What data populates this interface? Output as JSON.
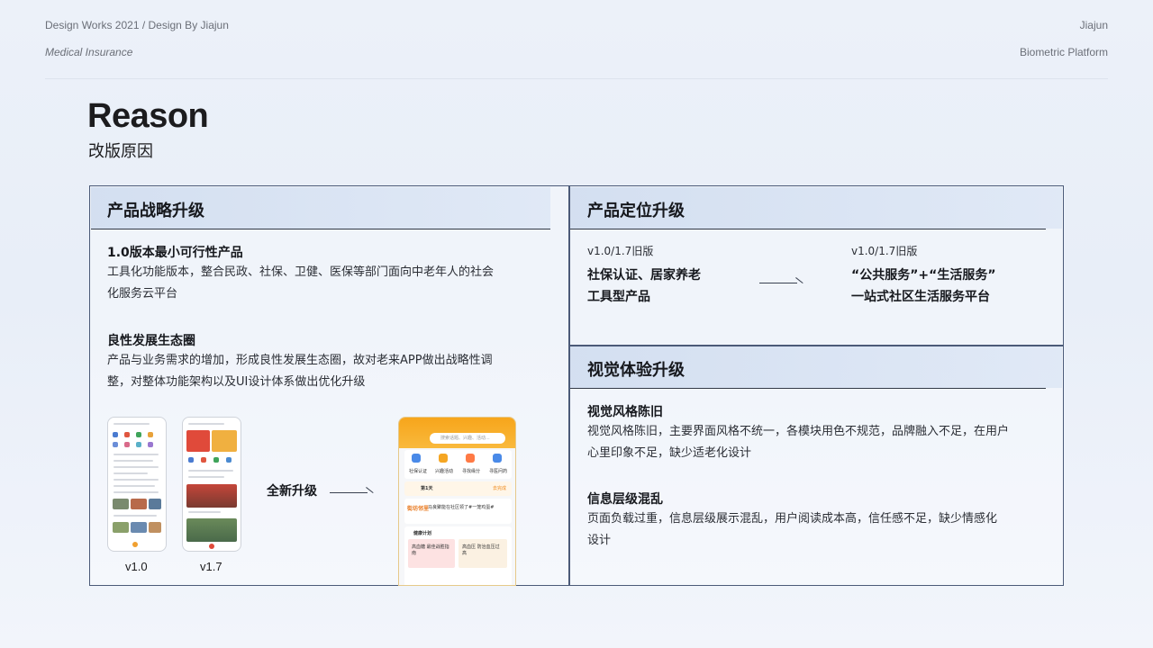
{
  "header": {
    "left_line1": "Design Works 2021 / Design By Jiajun",
    "left_line2": "Medical Insurance",
    "right_line1": "Jiajun",
    "right_line2": "Biometric Platform"
  },
  "title": {
    "en": "Reason",
    "zh": "改版原因"
  },
  "left_section": {
    "heading": "产品战略升级",
    "block1_title": "1.0版本最小可行性产品",
    "block1_line1": "工具化功能版本，整合民政、社保、卫健、医保等部门面向中老年人的社会",
    "block1_line2": "化服务云平台",
    "block2_title": "良性发展生态圈",
    "block2_line1": "产品与业务需求的增加，形成良性发展生态圈，故对老来APP做出战略性调",
    "block2_line2": "整，对整体功能架构以及UI设计体系做出优化升级",
    "version_a": "v1.0",
    "version_b": "v1.7",
    "upgrade_label": "全新升级",
    "new_app": {
      "search_placeholder": "搜索话题、兴趣、活动...",
      "entry1": "社保认证",
      "entry2": "兴趣活动",
      "entry3": "寻找缘分",
      "entry4": "寻医问药",
      "signin_day": "第1天",
      "signin_action": "去完成",
      "news_tag": "街坊邻里",
      "news_text": "马良聚能在社区领了#一笼鸡蛋#",
      "plan_title": "健康计划",
      "plan_card1": "高血糖 最佳战胜指南",
      "plan_card2": "高血压 防治血压过高"
    }
  },
  "right_top": {
    "heading": "产品定位升级",
    "left_version": "v1.0/1.7旧版",
    "left_line1": "社保认证、居家养老",
    "left_line2": "工具型产品",
    "right_version": "v1.0/1.7旧版",
    "right_line1": "“公共服务”+“生活服务”",
    "right_line2": "一站式社区生活服务平台"
  },
  "right_bottom": {
    "heading": "视觉体验升级",
    "block1_title": "视觉风格陈旧",
    "block1_line1": "视觉风格陈旧，主要界面风格不统一，各模块用色不规范，品牌融入不足，在用户",
    "block1_line2": "心里印象不足，缺少适老化设计",
    "block2_title": "信息层级混乱",
    "block2_line1": "页面负载过重，信息层级展示混乱，用户阅读成本高，信任感不足，缺少情感化",
    "block2_line2": "设计"
  },
  "colors": {
    "frame": "#4b5a78",
    "band": "#d3deef",
    "accent_orange": "#f7a51b"
  }
}
